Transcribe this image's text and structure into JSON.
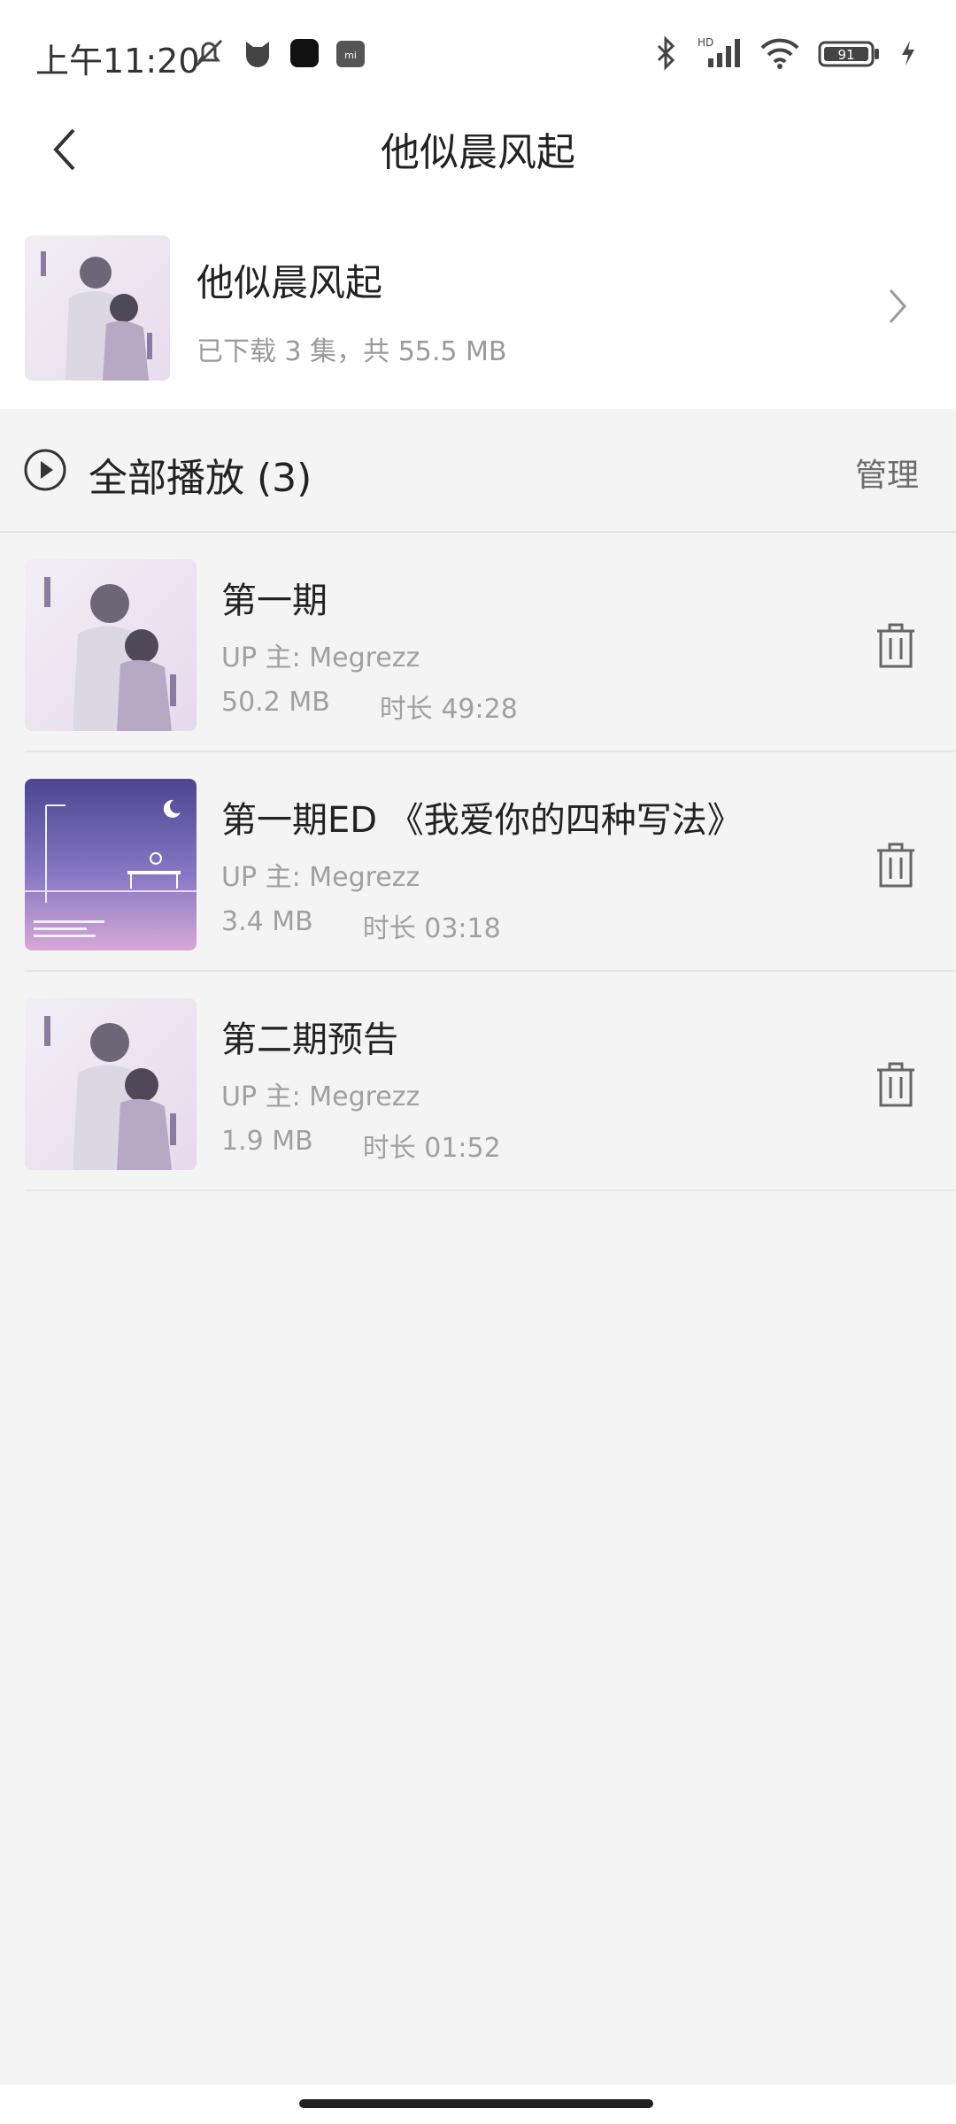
{
  "status_bar": {
    "time": "上午11:20",
    "battery": "91",
    "network_label": "HD",
    "app_icon_label": "mi"
  },
  "header": {
    "title": "他似晨风起"
  },
  "album": {
    "title": "他似晨风起",
    "subtitle": "已下载 3 集，共 55.5 MB"
  },
  "play_all": {
    "label": "全部播放 (3)",
    "manage_label": "管理"
  },
  "episodes": [
    {
      "title": "第一期",
      "up": "UP 主: Megrezz",
      "size": "50.2 MB",
      "duration": "时长 49:28",
      "cover": "couple-illustration"
    },
    {
      "title": "第一期ED 《我爱你的四种写法》",
      "up": "UP 主: Megrezz",
      "size": "3.4 MB",
      "duration": "时长 03:18",
      "cover": "purple-night-bench"
    },
    {
      "title": "第二期预告",
      "up": "UP 主: Megrezz",
      "size": "1.9 MB",
      "duration": "时长 01:52",
      "cover": "couple-illustration"
    }
  ],
  "colors": {
    "background": "#f4f4f4",
    "card": "#ffffff",
    "text_primary": "#222222",
    "text_secondary": "#a0a0a0",
    "cover_purple": "#7b6fb8"
  }
}
